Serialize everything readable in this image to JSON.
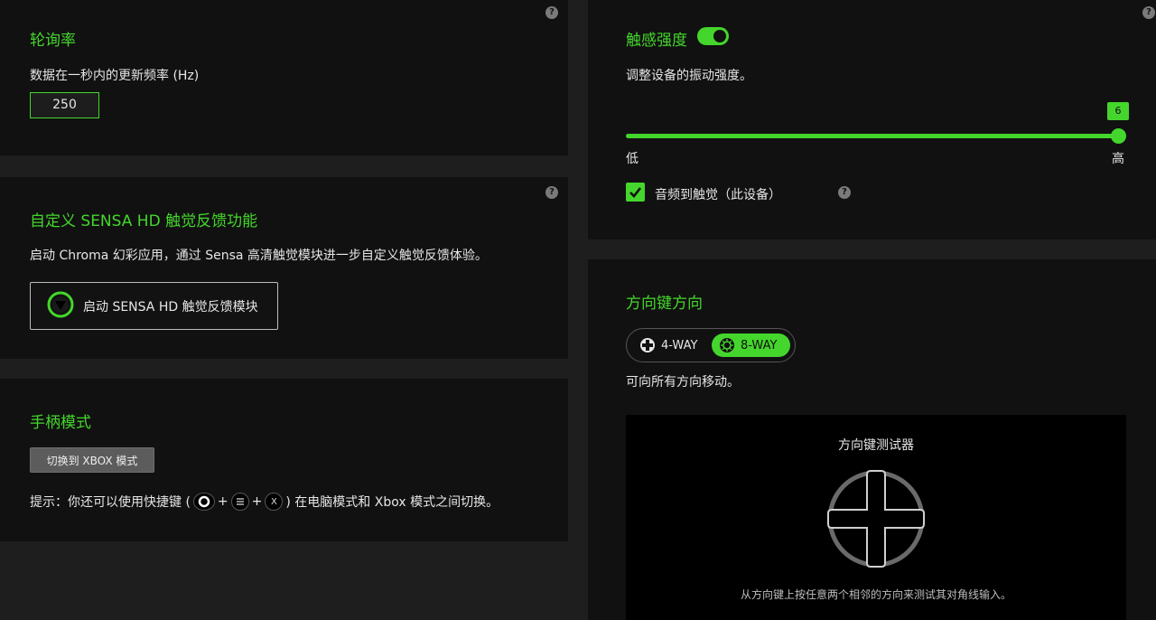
{
  "polling": {
    "title": "轮询率",
    "description": "数据在一秒内的更新频率 (Hz)",
    "value": "250",
    "help": "?"
  },
  "sensa": {
    "title": "自定义 SENSA HD 触觉反馈功能",
    "description": "启动 Chroma 幻彩应用，通过 Sensa 高清触觉模块进一步自定义触觉反馈体验。",
    "button_label": "启动 SENSA HD 触觉反馈模块",
    "help": "?"
  },
  "controller_mode": {
    "title": "手柄模式",
    "button_label": "切换到 XBOX 模式",
    "hint_prefix": "提示：你还可以使用快捷键 (",
    "plus": "+",
    "key_x": "X",
    "hint_suffix": ") 在电脑模式和 Xbox 模式之间切换。"
  },
  "haptics": {
    "title": "触感强度",
    "toggle_on": true,
    "description": "调整设备的振动强度。",
    "value": "6",
    "value_fraction": 1.0,
    "low_label": "低",
    "high_label": "高",
    "audio_checkbox_label": "音频到触觉（此设备）",
    "audio_checked": true,
    "help": "?"
  },
  "dpad": {
    "title": "方向键方向",
    "option_4way": "4-WAY",
    "option_8way": "8-WAY",
    "selected": "8-WAY",
    "description": "可向所有方向移动。",
    "tester_title": "方向键测试器",
    "tester_hint": "从方向键上按任意两个相邻的方向来测试其对角线输入。"
  },
  "colors": {
    "accent": "#44d62c",
    "panel": "#111111",
    "background": "#1e1e1e"
  }
}
